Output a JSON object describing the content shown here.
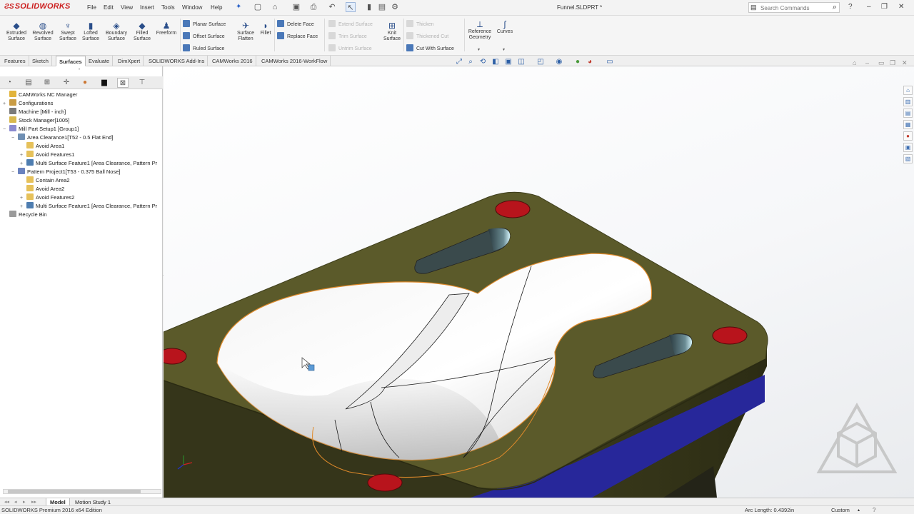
{
  "app": {
    "logo": "SOLIDWORKS",
    "menu": [
      "File",
      "Edit",
      "View",
      "Insert",
      "Tools",
      "Window",
      "Help"
    ],
    "document_title": "Funnel.SLDPRT *",
    "search_placeholder": "Search Commands"
  },
  "ribbon": {
    "large_buttons": [
      {
        "label1": "Extruded",
        "label2": "Surface",
        "icon": "extruded-surface-icon"
      },
      {
        "label1": "Revolved",
        "label2": "Surface",
        "icon": "revolved-surface-icon"
      },
      {
        "label1": "Swept",
        "label2": "Surface",
        "icon": "swept-surface-icon"
      },
      {
        "label1": "Lofted",
        "label2": "Surface",
        "icon": "lofted-surface-icon"
      },
      {
        "label1": "Boundary",
        "label2": "Surface",
        "icon": "boundary-surface-icon"
      },
      {
        "label1": "Filled",
        "label2": "Surface",
        "icon": "filled-surface-icon"
      },
      {
        "label1": "Freeform",
        "label2": "",
        "icon": "freeform-icon"
      }
    ],
    "group1": [
      "Planar Surface",
      "Offset Surface",
      "Ruled Surface"
    ],
    "surface_flatten": {
      "label1": "Surface",
      "label2": "Flatten"
    },
    "fillet": "Fillet",
    "group2": [
      "Delete Face",
      "Replace Face"
    ],
    "group3_disabled": [
      "Extend Surface",
      "Trim Surface",
      "Untrim Surface"
    ],
    "knit": {
      "label1": "Knit",
      "label2": "Surface"
    },
    "group4_disabled": [
      "Thicken",
      "Thickened Cut"
    ],
    "cut_with_surface": "Cut With Surface",
    "reference_geometry": {
      "label1": "Reference",
      "label2": "Geometry"
    },
    "curves": "Curves"
  },
  "tabs": [
    "Features",
    "Sketch",
    "Surfaces",
    "Evaluate",
    "DimXpert",
    "SOLIDWORKS Add-Ins",
    "CAMWorks 2016",
    "CAMWorks 2016-WorkFlow"
  ],
  "active_tab": "Surfaces",
  "tree": [
    {
      "label": "CAMWorks NC Manager",
      "level": 0,
      "icon": "ico-cam",
      "expander": ""
    },
    {
      "label": "Configurations",
      "level": 0,
      "icon": "ico-cfg",
      "expander": "+"
    },
    {
      "label": "Machine [Mill - inch]",
      "level": 0,
      "icon": "ico-mach",
      "expander": ""
    },
    {
      "label": "Stock Manager[1005]",
      "level": 0,
      "icon": "ico-stock",
      "expander": ""
    },
    {
      "label": "Mill Part Setup1 [Group1]",
      "level": 0,
      "icon": "ico-setup",
      "expander": "−"
    },
    {
      "label": "Area Clearance1[T52 - 0.5 Flat End]",
      "level": 1,
      "icon": "ico-area",
      "expander": "−"
    },
    {
      "label": "Avoid Area1",
      "level": 2,
      "icon": "ico-avoid",
      "expander": ""
    },
    {
      "label": "Avoid Features1",
      "level": 2,
      "icon": "ico-avoid",
      "expander": "+"
    },
    {
      "label": "Multi Surface Feature1 [Area Clearance, Pattern Pr",
      "level": 2,
      "icon": "ico-multi",
      "expander": "+"
    },
    {
      "label": "Pattern Project1[T53 - 0.375 Ball Nose]",
      "level": 1,
      "icon": "ico-pattern",
      "expander": "−"
    },
    {
      "label": "Contain Area2",
      "level": 2,
      "icon": "ico-avoid",
      "expander": ""
    },
    {
      "label": "Avoid Area2",
      "level": 2,
      "icon": "ico-avoid",
      "expander": ""
    },
    {
      "label": "Avoid Features2",
      "level": 2,
      "icon": "ico-avoid",
      "expander": "+"
    },
    {
      "label": "Multi Surface Feature1 [Area Clearance, Pattern Pr",
      "level": 2,
      "icon": "ico-multi",
      "expander": "+"
    },
    {
      "label": "Recycle Bin",
      "level": 0,
      "icon": "ico-bin",
      "expander": ""
    }
  ],
  "bottom_tabs": [
    "Model",
    "Motion Study 1"
  ],
  "status": {
    "edition": "SOLIDWORKS Premium 2016 x64 Edition",
    "measurement": "Arc Length: 0.4392in",
    "units": "Custom"
  },
  "colors": {
    "plate": "#5b5a2a",
    "plate_edge": "#3e3e1c",
    "bowl": "#ffffff",
    "blue_band": "#27279a",
    "hole": "#b8141c",
    "highlight": "#e08a2a",
    "accent": "#cc1f1f"
  }
}
